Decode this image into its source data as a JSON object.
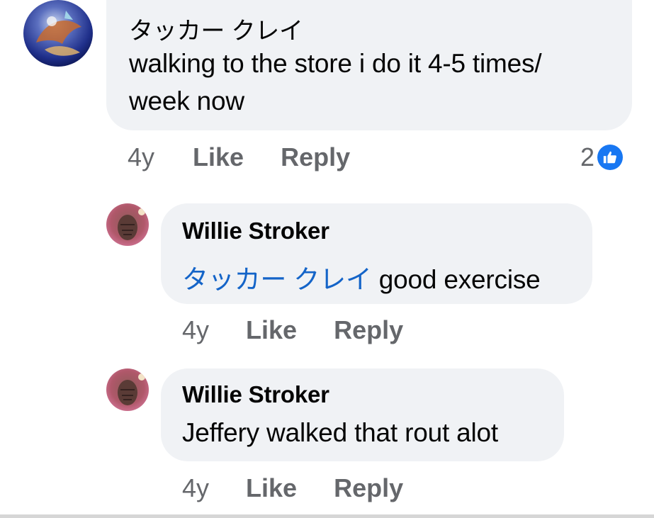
{
  "comments": [
    {
      "author": "タッカー クレイ",
      "text_line1": "walking to the store i do it 4-5 times/",
      "text_line2": "week now",
      "age": "4y",
      "like_label": "Like",
      "reply_label": "Reply",
      "reaction_count": "2"
    },
    {
      "author": "Willie Stroker",
      "mention": "タッカー クレイ",
      "text": "good exercise",
      "age": "4y",
      "like_label": "Like",
      "reply_label": "Reply"
    },
    {
      "author": "Willie Stroker",
      "text": "Jeffery walked that rout alot",
      "age": "4y",
      "like_label": "Like",
      "reply_label": "Reply"
    }
  ],
  "icons": {
    "reaction": "like-thumb-icon"
  },
  "colors": {
    "bubble": "#f0f2f5",
    "mention": "#1464c8",
    "meta": "#65676b",
    "like_badge": "#1877f2"
  }
}
